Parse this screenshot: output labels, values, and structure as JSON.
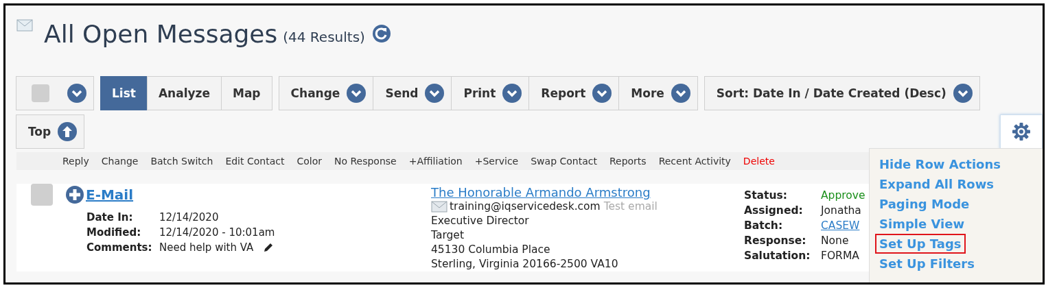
{
  "header": {
    "title": "All Open Messages",
    "count": "(44 Results)"
  },
  "toolbar": {
    "select_all": {
      "checked": false
    },
    "views": [
      {
        "label": "List",
        "selected": true
      },
      {
        "label": "Analyze",
        "selected": false
      },
      {
        "label": "Map",
        "selected": false
      }
    ],
    "actions": [
      {
        "label": "Change"
      },
      {
        "label": "Send"
      },
      {
        "label": "Print"
      },
      {
        "label": "Report"
      },
      {
        "label": "More"
      }
    ],
    "sort": "Sort: Date In / Date Created (Desc)",
    "top": "Top"
  },
  "row_actions": [
    {
      "label": "Reply",
      "kind": "normal"
    },
    {
      "label": "Change",
      "kind": "normal"
    },
    {
      "label": "Batch Switch",
      "kind": "normal"
    },
    {
      "label": "Edit Contact",
      "kind": "normal"
    },
    {
      "label": "Color",
      "kind": "normal"
    },
    {
      "label": "No Response",
      "kind": "normal"
    },
    {
      "label": "+Affiliation",
      "kind": "normal"
    },
    {
      "label": "+Service",
      "kind": "normal"
    },
    {
      "label": "Swap Contact",
      "kind": "normal"
    },
    {
      "label": "Reports",
      "kind": "normal"
    },
    {
      "label": "Recent Activity",
      "kind": "normal"
    },
    {
      "label": "Delete",
      "kind": "danger"
    }
  ],
  "message": {
    "checked": false,
    "type": "E-Mail",
    "fields": [
      {
        "label": "Date In:",
        "value": "12/14/2020",
        "kind": "text"
      },
      {
        "label": "Modified:",
        "value": "12/14/2020 - 10:01am",
        "kind": "text"
      },
      {
        "label": "Comments:",
        "value": "Need help with VA",
        "kind": "editable"
      }
    ]
  },
  "contact": {
    "name": "The Honorable Armando Armstrong",
    "email": "training@iqservicedesk.com",
    "email_note": "Test email",
    "lines": [
      "Executive Director",
      "Target",
      "45130 Columbia Place",
      "Sterling, Virginia 20166-2500 VA10"
    ]
  },
  "details": [
    {
      "label": "Status:",
      "value": "Approve",
      "kind": "status"
    },
    {
      "label": "Assigned:",
      "value": "Jonatha",
      "kind": "text"
    },
    {
      "label": "Batch:",
      "value": "CASEW",
      "kind": "link"
    },
    {
      "label": "Response:",
      "value": "None",
      "kind": "text"
    },
    {
      "label": "Salutation:",
      "value": "FORMA",
      "kind": "text"
    }
  ],
  "settings_menu": {
    "expanded": true,
    "items": [
      {
        "label": "Hide Row Actions",
        "highlighted": false
      },
      {
        "label": "Expand All Rows",
        "highlighted": false
      },
      {
        "label": "Paging Mode",
        "highlighted": false
      },
      {
        "label": "Simple View",
        "highlighted": false
      },
      {
        "label": "Set Up Tags",
        "highlighted": true
      },
      {
        "label": "Set Up Filters",
        "highlighted": false
      }
    ]
  }
}
